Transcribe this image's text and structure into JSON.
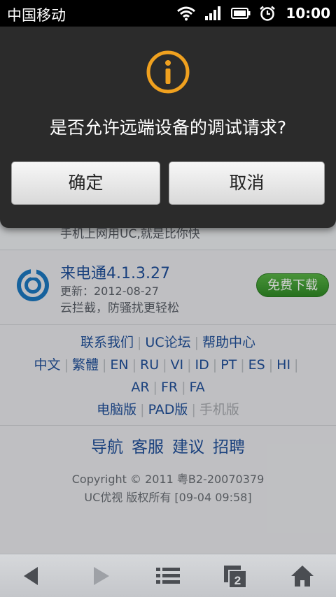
{
  "status_bar": {
    "carrier": "中国移动",
    "time": "10:00"
  },
  "dialog": {
    "message": "是否允许远端设备的调试请求?",
    "confirm_label": "确定",
    "cancel_label": "取消"
  },
  "apps": [
    {
      "desc": "手机上网用UC,就是比你快"
    },
    {
      "title": "来电通4.1.3.27",
      "date": "更新：2012-08-27",
      "desc": "云拦截，防骚扰更轻松",
      "download_label": "免费下载"
    }
  ],
  "footer_links": {
    "row1": [
      "联系我们",
      "UC论坛",
      "帮助中心"
    ],
    "row2": [
      "中文",
      "繁體",
      "EN",
      "RU",
      "VI",
      "ID",
      "PT",
      "ES",
      "HI"
    ],
    "row3": [
      "AR",
      "FR",
      "FA"
    ],
    "row4": [
      "电脑版",
      "PAD版",
      "手机版"
    ]
  },
  "nav": [
    "导航",
    "客服",
    "建议",
    "招聘"
  ],
  "copyright": [
    "Copyright © 2011 粤B2-20070379",
    "UC优视 版权所有 [09-04 09:58]"
  ],
  "toolbar": {
    "tabs_count": "2"
  },
  "colors": {
    "link": "#1f4f99",
    "dialog_bg": "#2b2b2b",
    "accent_orange": "#f0a11f",
    "download_green": "#3a9a2e"
  }
}
